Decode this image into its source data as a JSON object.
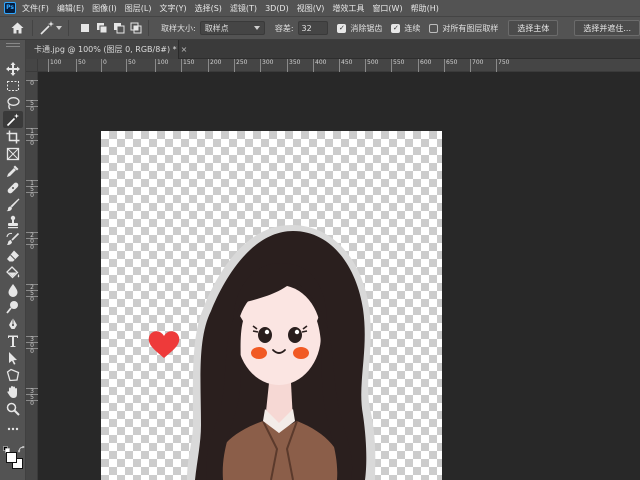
{
  "app": {
    "logo_text": "Ps"
  },
  "menu": [
    "文件(F)",
    "编辑(E)",
    "图像(I)",
    "图层(L)",
    "文字(Y)",
    "选择(S)",
    "滤镜(T)",
    "3D(D)",
    "视图(V)",
    "增效工具",
    "窗口(W)",
    "帮助(H)"
  ],
  "options": {
    "sample_size_label": "取样大小:",
    "sample_size_value": "取样点",
    "tolerance_label": "容差:",
    "tolerance_value": "32",
    "anti_alias_label": "消除锯齿",
    "anti_alias_checked": true,
    "contiguous_label": "连续",
    "contiguous_checked": true,
    "sample_all_layers_label": "对所有图层取样",
    "sample_all_layers_checked": false,
    "select_subject_label": "选择主体",
    "select_and_mask_label": "选择并遮住..."
  },
  "document_tab": {
    "title": "卡通.jpg @ 100% (图层 0, RGB/8#) *",
    "close_glyph": "×"
  },
  "ruler_top_labels": [
    "100",
    "50",
    "0",
    "50",
    "100",
    "150",
    "200",
    "250",
    "300",
    "350",
    "400",
    "450",
    "500",
    "550",
    "600",
    "650",
    "700",
    "750"
  ],
  "ruler_left_labels": [
    "0",
    "5",
    "0",
    "1",
    "0",
    "0",
    "1",
    "5",
    "0",
    "2",
    "0",
    "0",
    "2",
    "5",
    "0",
    "3",
    "0",
    "0",
    "3",
    "5",
    "0"
  ],
  "tools": [
    "move-icon",
    "marquee-icon",
    "lasso-icon",
    "magic-wand-icon",
    "crop-icon",
    "frame-icon",
    "eyedropper-icon",
    "healing-brush-icon",
    "brush-icon",
    "stamp-icon",
    "history-brush-icon",
    "eraser-icon",
    "paint-bucket-icon",
    "blur-icon",
    "dodge-icon",
    "pen-icon",
    "type-icon",
    "path-select-icon",
    "shape-icon",
    "hand-icon",
    "zoom-icon",
    "more-tools-icon"
  ],
  "active_tool": "magic-wand-icon",
  "colors": {
    "foreground": "#ffffff",
    "background": "#ffffff",
    "hair": "#2a1f1e",
    "skin": "#fbe5e2",
    "blush": "#f15a24",
    "coat": "#8b5e49",
    "heart": "#ee3a3a",
    "outline": "#d9d9d9"
  }
}
